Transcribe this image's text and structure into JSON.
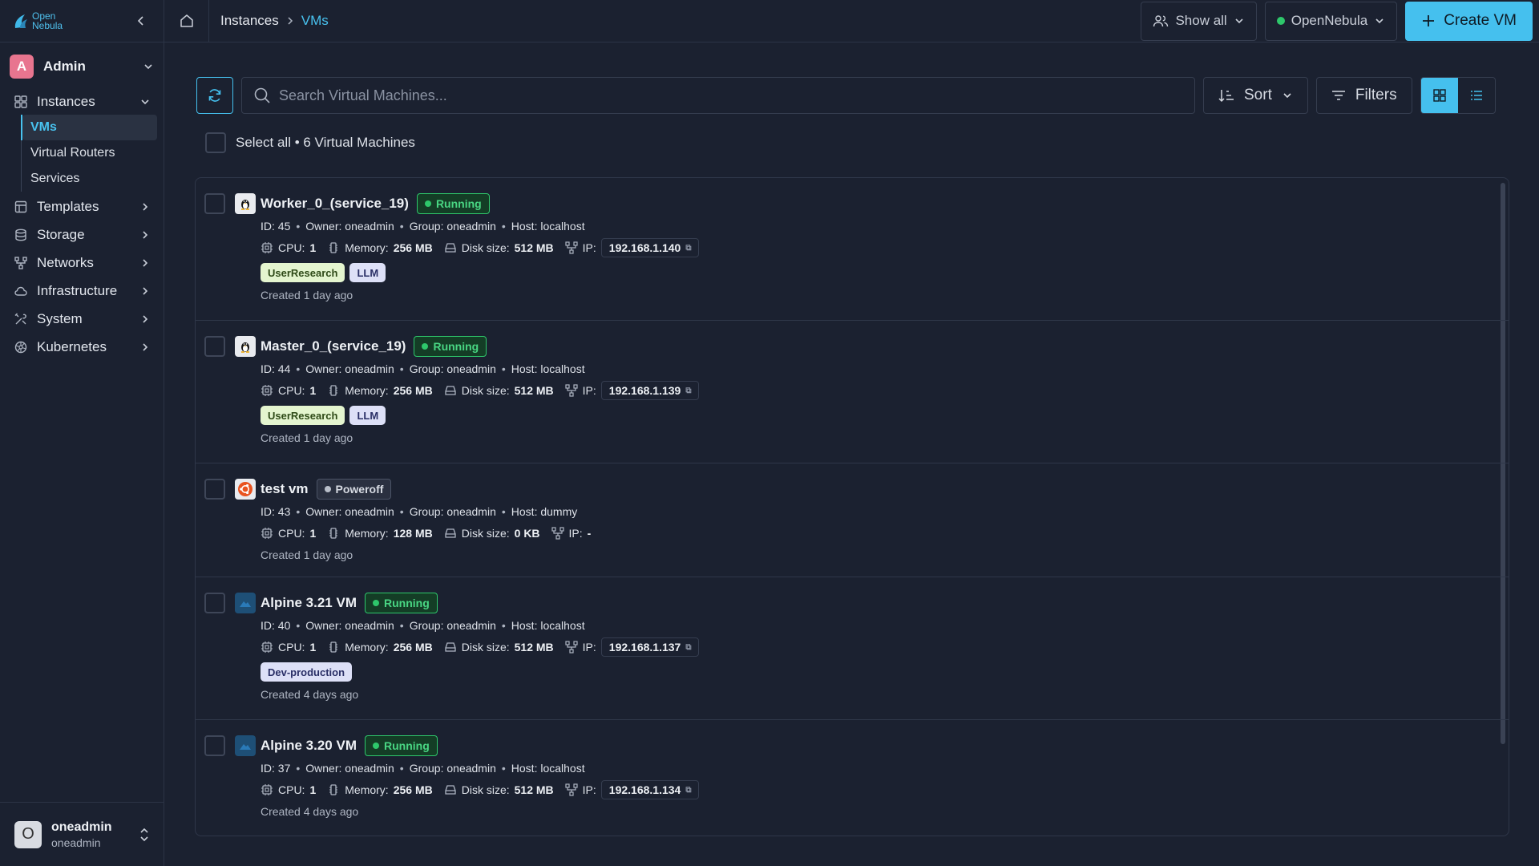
{
  "brand": {
    "logo_line1": "Open",
    "logo_line2": "Nebula",
    "accent": "#45c0ee"
  },
  "sidebar": {
    "admin_initial": "A",
    "admin_label": "Admin",
    "instances_label": "Instances",
    "sub_items": [
      "VMs",
      "Virtual Routers",
      "Services"
    ],
    "items": [
      "Templates",
      "Storage",
      "Networks",
      "Infrastructure",
      "System",
      "Kubernetes"
    ],
    "user": {
      "initial": "O",
      "name": "oneadmin",
      "group": "oneadmin"
    }
  },
  "topbar": {
    "breadcrumb": [
      "Instances",
      "VMs"
    ],
    "show_all": "Show all",
    "zone": "OpenNebula",
    "create": "Create VM"
  },
  "toolbar": {
    "search_placeholder": "Search Virtual Machines...",
    "sort": "Sort",
    "filters": "Filters"
  },
  "select_all": "Select all • 6 Virtual Machines",
  "labels": {
    "cpu": "CPU:",
    "memory": "Memory:",
    "disk": "Disk size:",
    "ip": "IP:"
  },
  "vms": [
    {
      "name": "Worker_0_(service_19)",
      "os_icon": "linux-tux-icon",
      "state": "Running",
      "info": [
        "ID: 45",
        "Owner: oneadmin",
        "Group: oneadmin",
        "Host: localhost"
      ],
      "cpu": "1",
      "memory": "256 MB",
      "disk": "512 MB",
      "ip": "192.168.1.140",
      "tags": [
        {
          "text": "UserResearch",
          "color": "green"
        },
        {
          "text": "LLM",
          "color": "blue"
        }
      ],
      "created": "Created 1 day ago"
    },
    {
      "name": "Master_0_(service_19)",
      "os_icon": "linux-tux-icon",
      "state": "Running",
      "info": [
        "ID: 44",
        "Owner: oneadmin",
        "Group: oneadmin",
        "Host: localhost"
      ],
      "cpu": "1",
      "memory": "256 MB",
      "disk": "512 MB",
      "ip": "192.168.1.139",
      "tags": [
        {
          "text": "UserResearch",
          "color": "green"
        },
        {
          "text": "LLM",
          "color": "blue"
        }
      ],
      "created": "Created 1 day ago"
    },
    {
      "name": "test vm",
      "os_icon": "ubuntu-icon",
      "state": "Poweroff",
      "info": [
        "ID: 43",
        "Owner: oneadmin",
        "Group: oneadmin",
        "Host: dummy"
      ],
      "cpu": "1",
      "memory": "128 MB",
      "disk": "0 KB",
      "ip": "-",
      "tags": [],
      "created": "Created 1 day ago"
    },
    {
      "name": "Alpine 3.21 VM",
      "os_icon": "alpine-icon",
      "state": "Running",
      "info": [
        "ID: 40",
        "Owner: oneadmin",
        "Group: oneadmin",
        "Host: localhost"
      ],
      "cpu": "1",
      "memory": "256 MB",
      "disk": "512 MB",
      "ip": "192.168.1.137",
      "tags": [
        {
          "text": "Dev-production",
          "color": "blue"
        }
      ],
      "created": "Created 4 days ago"
    },
    {
      "name": "Alpine 3.20 VM",
      "os_icon": "alpine-icon",
      "state": "Running",
      "info": [
        "ID: 37",
        "Owner: oneadmin",
        "Group: oneadmin",
        "Host: localhost"
      ],
      "cpu": "1",
      "memory": "256 MB",
      "disk": "512 MB",
      "ip": "192.168.1.134",
      "tags": [],
      "created": "Created 4 days ago"
    }
  ]
}
